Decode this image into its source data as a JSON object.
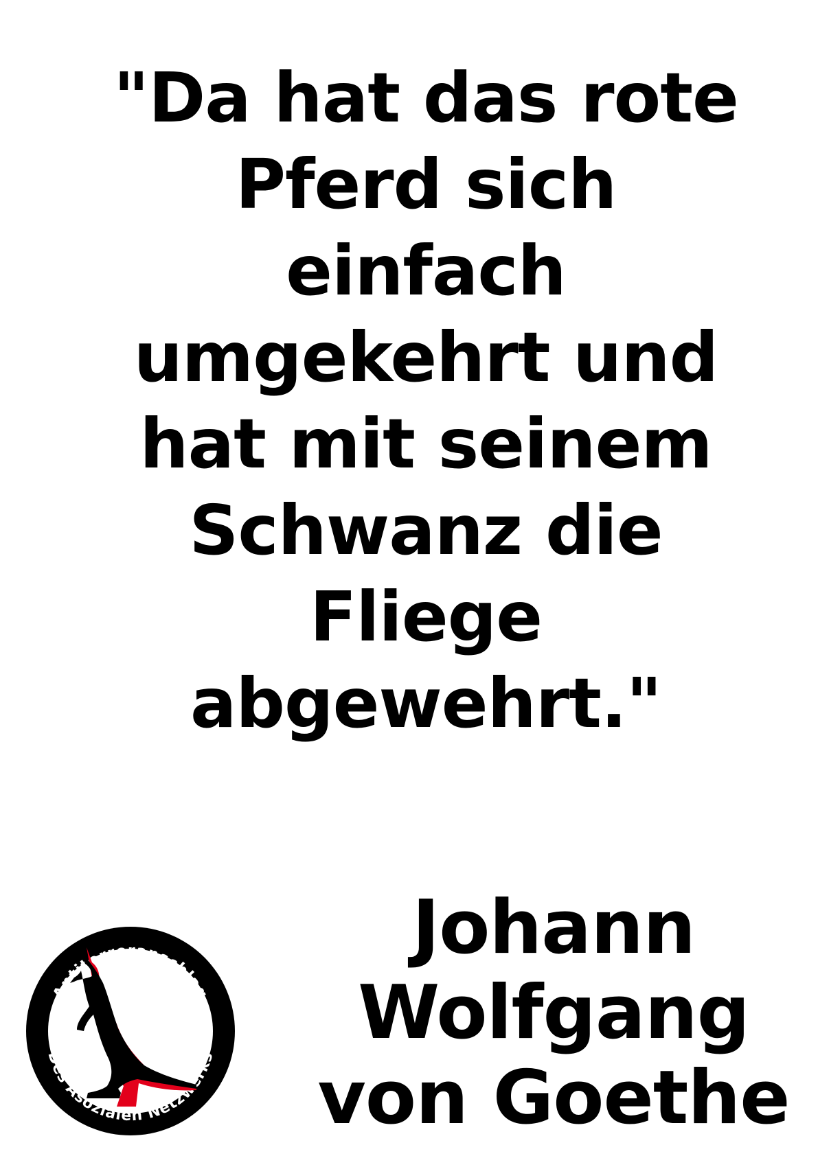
{
  "quote": {
    "lines": [
      "\"Da hat das rote",
      "Pferd sich",
      "einfach",
      "umgekehrt und",
      "hat mit seinem",
      "Schwanz die",
      "Fliege",
      "abgewehrt.\""
    ]
  },
  "author": {
    "lines": [
      "Johann",
      "Wolfgang",
      "von Goethe"
    ]
  },
  "logo": {
    "top_text": "Antiterroranschlag",
    "bottom_text": "Des Asozialen Netzwerks",
    "icon": "kangaroo-icon",
    "ring_color": "#000000",
    "accent_color": "#e3001b"
  }
}
